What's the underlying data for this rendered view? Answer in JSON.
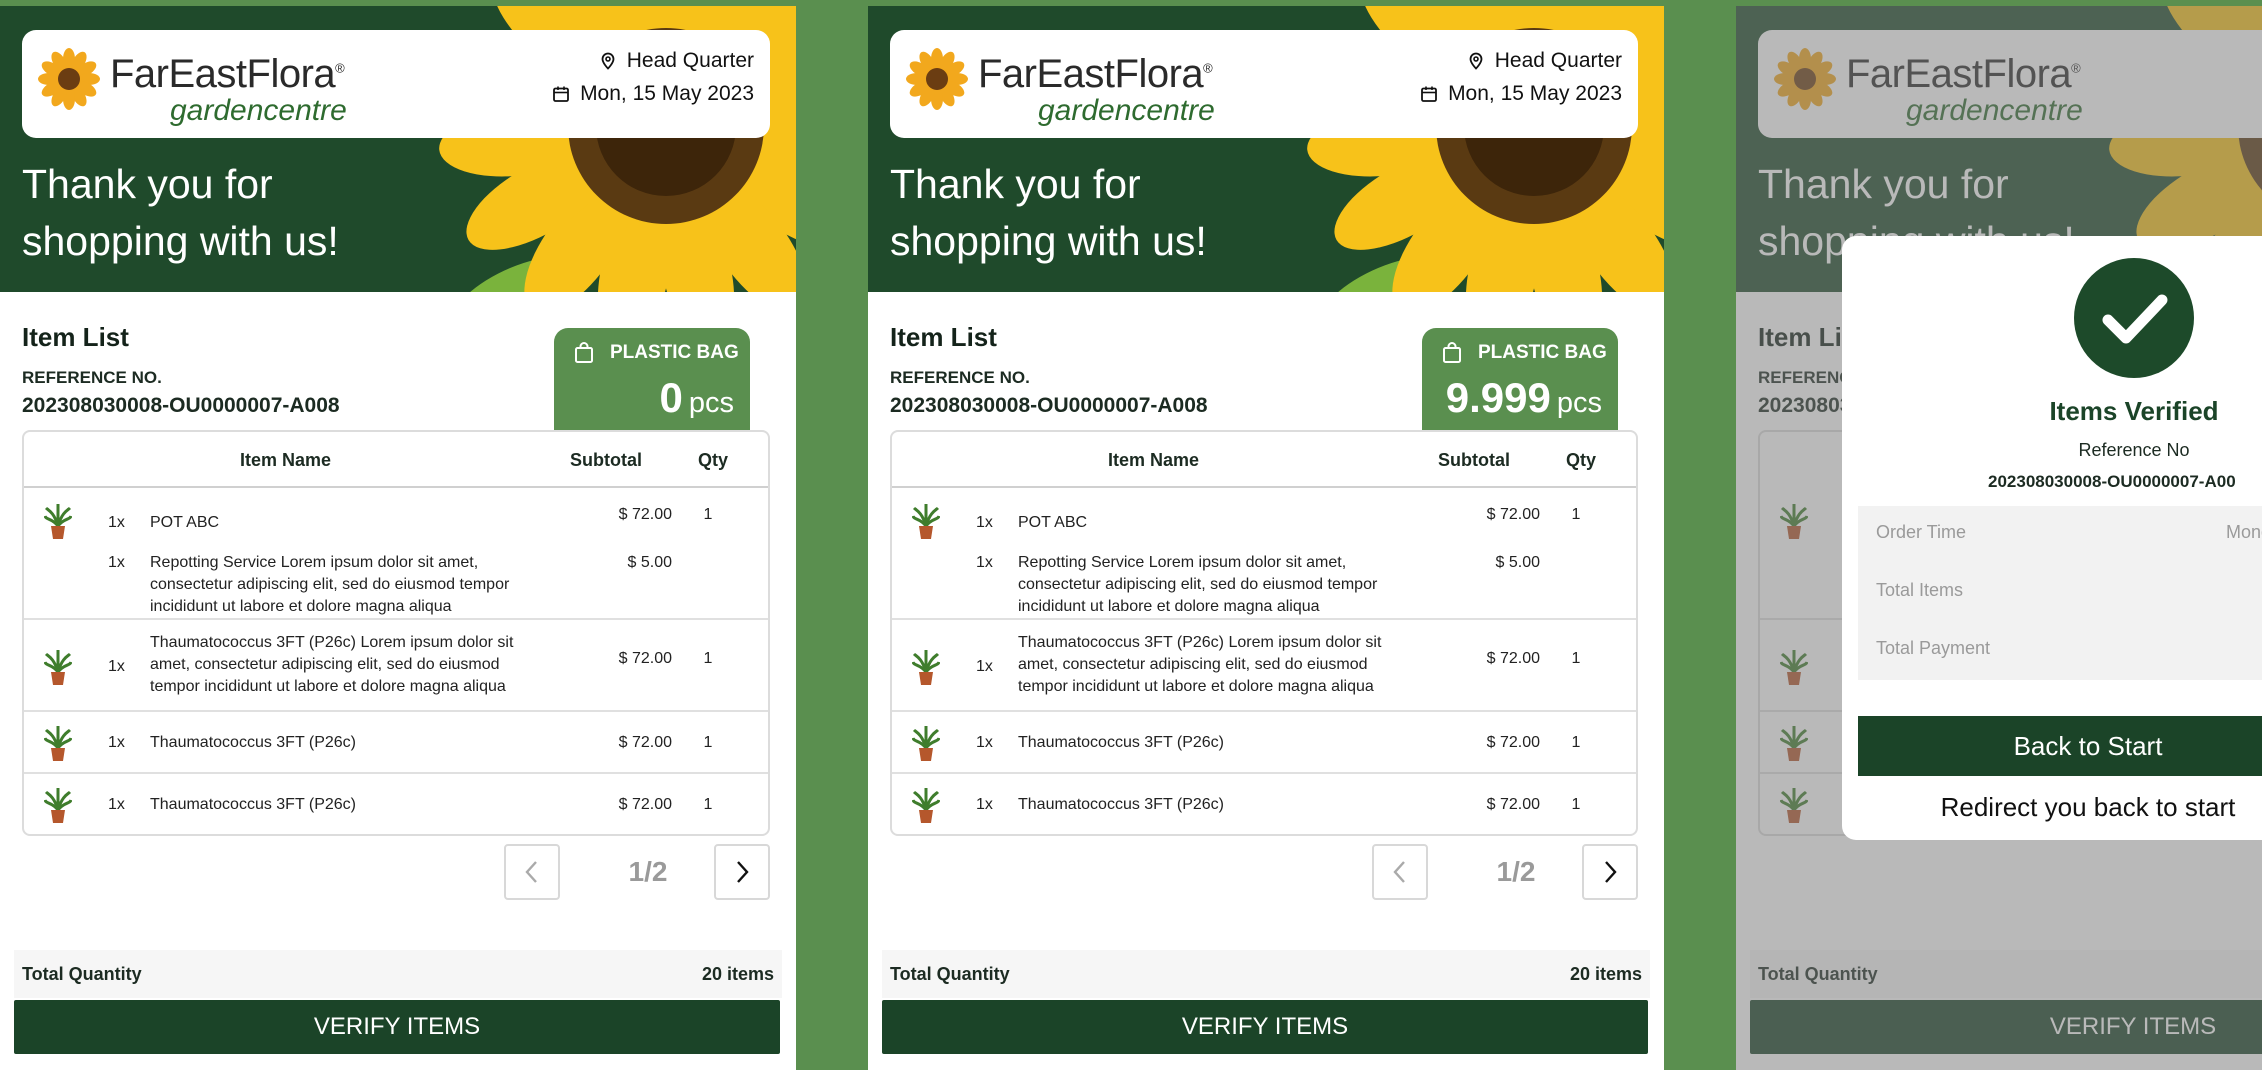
{
  "brand": {
    "name": "FarEastFlora",
    "reg": "®",
    "sub": "gardencentre"
  },
  "header": {
    "location": "Head Quarter",
    "date": "Mon, 15 May 2023",
    "thanks_line1": "Thank you for",
    "thanks_line2": "shopping with us!"
  },
  "list": {
    "title": "Item List",
    "ref_label": "REFERENCE NO.",
    "ref_no": "202308030008-OU0000007-A008",
    "bag_label": "PLASTIC BAG",
    "bag_unit": "pcs",
    "col_name": "Item Name",
    "col_subtotal": "Subtotal",
    "col_qty": "Qty",
    "items": [
      {
        "qx": "1x",
        "name": "POT ABC",
        "subtotal": "$ 72.00",
        "qty": "1"
      },
      {
        "qx": "1x",
        "name": "Repotting Service Lorem ipsum dolor sit amet, consectetur adipiscing elit, sed do eiusmod tempor incididunt ut labore et dolore magna aliqua",
        "subtotal": "$ 5.00",
        "qty": ""
      },
      {
        "qx": "1x",
        "name": "Thaumatococcus 3FT (P26c) Lorem ipsum dolor sit amet, consectetur adipiscing elit, sed do eiusmod tempor incididunt ut labore et dolore magna aliqua",
        "subtotal": "$ 72.00",
        "qty": "1"
      },
      {
        "qx": "1x",
        "name": "Thaumatococcus 3FT (P26c)",
        "subtotal": "$ 72.00",
        "qty": "1"
      },
      {
        "qx": "1x",
        "name": "Thaumatococcus 3FT (P26c)",
        "subtotal": "$ 72.00",
        "qty": "1"
      }
    ],
    "page": "1/2",
    "total_label": "Total Quantity",
    "total_value": "20 items",
    "verify_label": "VERIFY ITEMS"
  },
  "panels": [
    {
      "bag_count": "0"
    },
    {
      "bag_count": "9.999"
    },
    {
      "bag_count": ""
    }
  ],
  "modal": {
    "title": "Items Verified",
    "ref_label": "Reference No",
    "ref_no": "202308030008-OU0000007-A00",
    "order_time_label": "Order Time",
    "order_time_value": "Mond",
    "total_items_label": "Total Items",
    "total_payment_label": "Total Payment",
    "back_label": "Back to Start",
    "redirect_text": "Redirect you back to start"
  },
  "colors": {
    "accent": "#1b4428",
    "brand_green": "#5a8f4f",
    "hero": "#1f4a2b"
  },
  "icons": [
    "location-pin-icon",
    "calendar-icon",
    "shopping-bag-icon",
    "plant-icon",
    "chevron-left-icon",
    "chevron-right-icon",
    "check-icon"
  ]
}
